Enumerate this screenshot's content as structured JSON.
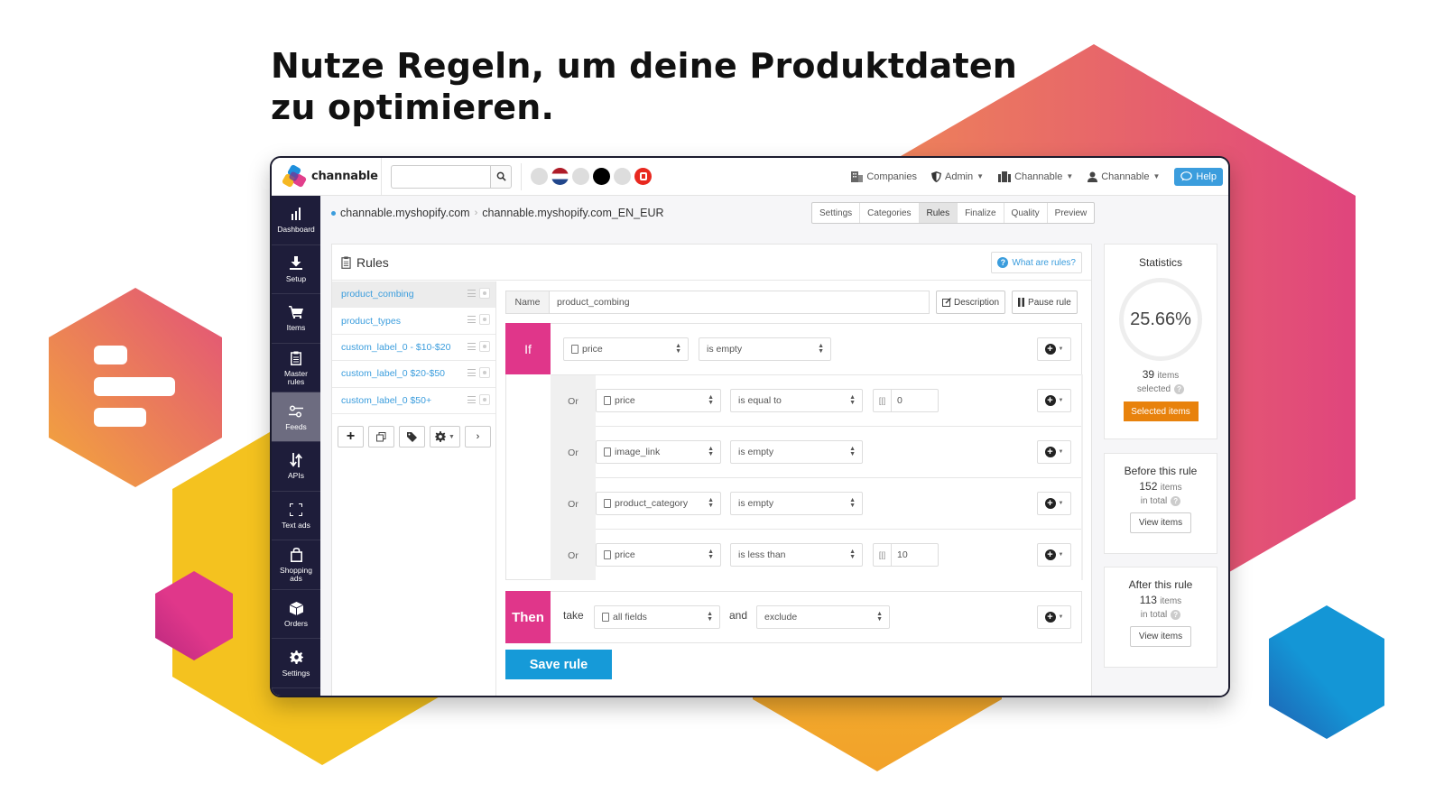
{
  "headline": {
    "line1": "Nutze Regeln, um deine Produktdaten",
    "line2": "zu optimieren."
  },
  "colors": {
    "accent_pink": "#e0368a",
    "accent_blue": "#169ad8",
    "accent_orange": "#e8820c",
    "sidebar_bg": "#1e1d3a",
    "link_blue": "#3b9ddd"
  },
  "topbar": {
    "brand": "channable",
    "search_placeholder": "",
    "search_icon": "search-icon",
    "project_dots": [
      "grey",
      "netherlands-flag",
      "grey",
      "black",
      "grey",
      "red-app"
    ],
    "nav": [
      {
        "label": "Companies",
        "icon": "building-icon",
        "dropdown": false
      },
      {
        "label": "Admin",
        "icon": "shield-icon",
        "dropdown": true
      },
      {
        "label": "Channable",
        "icon": "company-icon",
        "dropdown": true
      },
      {
        "label": "Channable",
        "icon": "user-icon",
        "dropdown": true
      }
    ],
    "help_label": "Help"
  },
  "sidebar": {
    "items": [
      {
        "label": "Dashboard",
        "icon": "bar-chart-icon"
      },
      {
        "label": "Setup",
        "icon": "download-icon"
      },
      {
        "label": "Items",
        "icon": "cart-icon"
      },
      {
        "label": "Master rules",
        "icon": "clipboard-icon"
      },
      {
        "label": "Feeds",
        "icon": "sliders-icon",
        "active": true
      },
      {
        "label": "APIs",
        "icon": "arrows-updown-icon"
      },
      {
        "label": "Text ads",
        "icon": "frame-icon"
      },
      {
        "label": "Shopping ads",
        "icon": "shopping-bag-icon"
      },
      {
        "label": "Orders",
        "icon": "box-icon"
      },
      {
        "label": "Settings",
        "icon": "gear-icon"
      }
    ]
  },
  "breadcrumb": {
    "items": [
      "channable.myshopify.com",
      "channable.myshopify.com_EN_EUR"
    ]
  },
  "steps": {
    "items": [
      "Settings",
      "Categories",
      "Rules",
      "Finalize",
      "Quality",
      "Preview"
    ],
    "active": "Rules"
  },
  "rules_panel": {
    "title": "Rules",
    "help_link": "What are rules?",
    "list": [
      {
        "name": "product_combing",
        "active": true
      },
      {
        "name": "product_types"
      },
      {
        "name": "custom_label_0 - $10-$20"
      },
      {
        "name": "custom_label_0 $20-$50"
      },
      {
        "name": "custom_label_0 $50+"
      }
    ],
    "tools": [
      "plus-icon",
      "copy-icon",
      "tag-icon",
      "gear-dropdown-icon",
      "chevron-right-icon"
    ]
  },
  "editor": {
    "name_label": "Name",
    "name_value": "product_combing",
    "description_btn": "Description",
    "pause_btn": "Pause rule",
    "if_label": "If",
    "or_label": "Or",
    "conditions": [
      {
        "field": "price",
        "operator": "is empty",
        "value": null
      },
      {
        "field": "price",
        "operator": "is equal to",
        "value": "0"
      },
      {
        "field": "image_link",
        "operator": "is empty",
        "value": null
      },
      {
        "field": "product_category",
        "operator": "is empty",
        "value": null
      },
      {
        "field": "price",
        "operator": "is less than",
        "value": "10"
      }
    ],
    "then": {
      "label": "Then",
      "take_word": "take",
      "take_field": "all fields",
      "and_word": "and",
      "action": "exclude"
    },
    "save_label": "Save rule"
  },
  "statistics": {
    "title": "Statistics",
    "percent": "25.66%",
    "selected_count": "39",
    "items_word": "items",
    "selected_word": "selected",
    "selected_btn": "Selected items",
    "before": {
      "title": "Before this rule",
      "count": "152",
      "sub": "in total",
      "btn": "View items"
    },
    "after": {
      "title": "After this rule",
      "count": "113",
      "sub": "in total",
      "btn": "View items"
    }
  }
}
